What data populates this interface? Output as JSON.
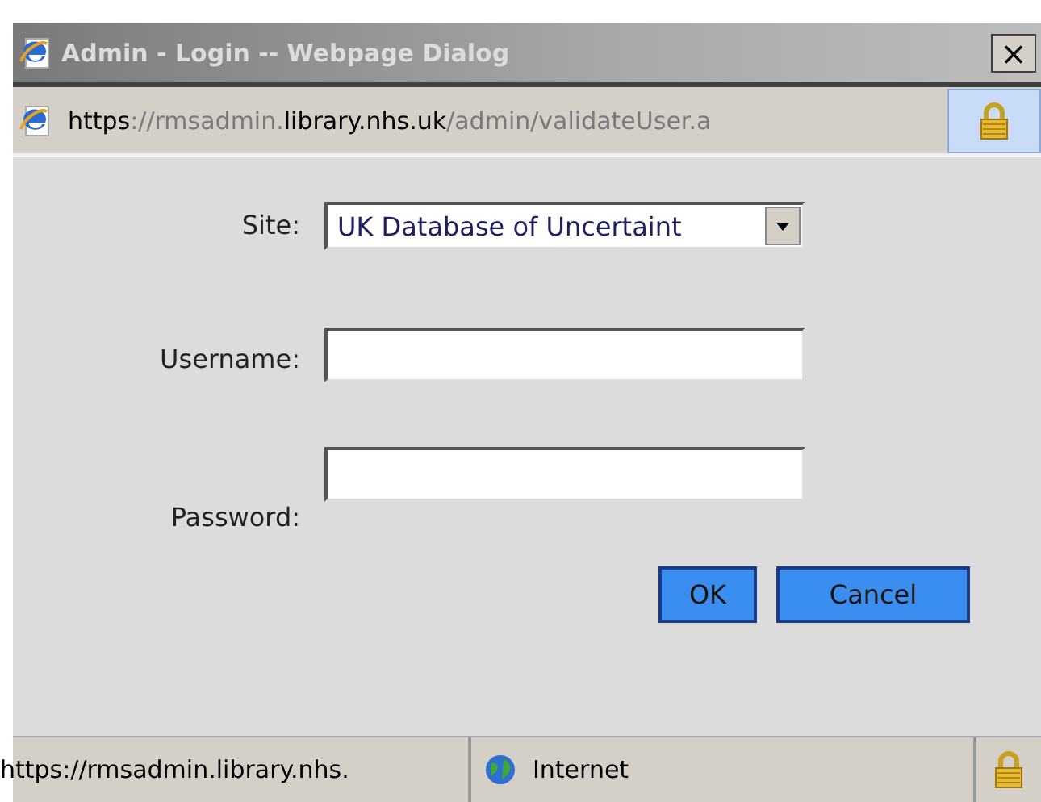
{
  "window": {
    "title": "Admin - Login -- Webpage Dialog",
    "close": "×"
  },
  "address_bar": {
    "url_parts": [
      {
        "text": "https",
        "dim": false
      },
      {
        "text": "://rmsadmin.",
        "dim": true
      },
      {
        "text": "library.nhs.uk",
        "dim": false
      },
      {
        "text": "/admin/validateUser.a",
        "dim": true
      }
    ]
  },
  "form": {
    "fields": [
      {
        "kind": "select",
        "label": "Site:",
        "value": "UK Database of Uncertaint"
      },
      {
        "kind": "text",
        "label": "Username:"
      },
      {
        "kind": "password",
        "label": "Password:"
      }
    ],
    "buttons": [
      {
        "label": "OK"
      },
      {
        "label": "Cancel"
      }
    ]
  },
  "status_bar": {
    "url": "https://rmsadmin.library.nhs.",
    "zone": "Internet"
  }
}
